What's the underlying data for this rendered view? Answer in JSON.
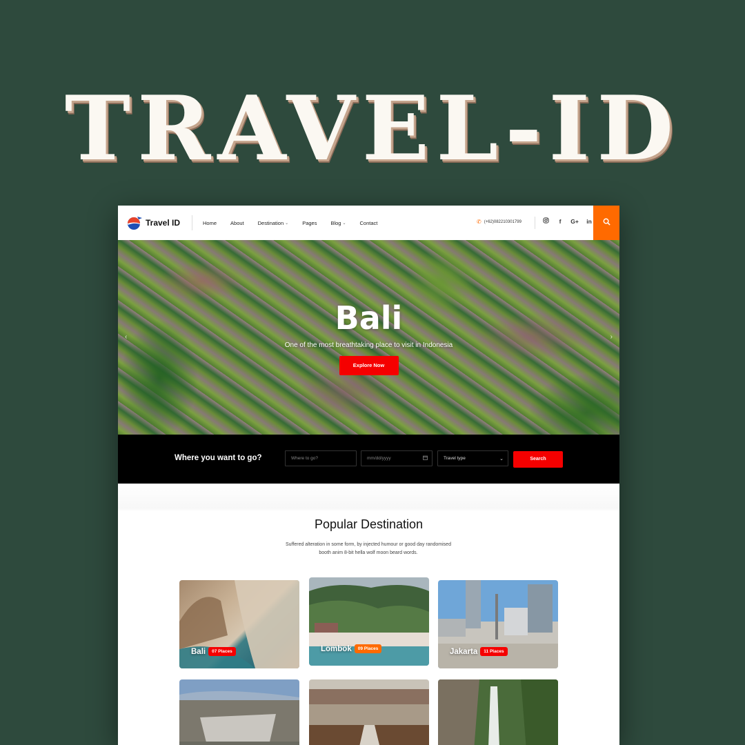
{
  "poster": {
    "title": "TRAVEL-ID"
  },
  "header": {
    "logo_text": "Travel ID",
    "nav": [
      {
        "label": "Home",
        "dropdown": false
      },
      {
        "label": "About",
        "dropdown": false
      },
      {
        "label": "Destination",
        "dropdown": true
      },
      {
        "label": "Pages",
        "dropdown": false
      },
      {
        "label": "Blog",
        "dropdown": true
      },
      {
        "label": "Contact",
        "dropdown": false
      }
    ],
    "phone": "(+62)082210301799",
    "socials": [
      "instagram-icon",
      "facebook-icon",
      "google-plus-icon",
      "linkedin-icon"
    ],
    "social_glyphs": {
      "fb": "f",
      "gp": "G+",
      "li": "in"
    },
    "search_icon": "search-icon",
    "accent": "#ff6a00"
  },
  "hero": {
    "title": "Bali",
    "subtitle": "One of the most breathtaking place to visit in Indonesia",
    "cta": "Explore Now",
    "cta_color": "#f50000"
  },
  "search": {
    "label": "Where you want to go?",
    "where_placeholder": "Where to go?",
    "date_placeholder": "mm/dd/yyyy",
    "travel_type": "Travel type",
    "button": "Search"
  },
  "popular": {
    "title": "Popular Destination",
    "description": "Suffered alteration in some form, by injected humour or good day randomised booth anim 8-bit hella wolf moon beard words.",
    "cards": [
      {
        "name": "Bali",
        "badge": "07 Places",
        "badge_color": "#f50000"
      },
      {
        "name": "Lombok",
        "badge": "09 Places",
        "badge_color": "#ff6a00"
      },
      {
        "name": "Jakarta",
        "badge": "11 Places",
        "badge_color": "#f50000"
      },
      {
        "name": "",
        "badge": ""
      },
      {
        "name": "",
        "badge": ""
      },
      {
        "name": "",
        "badge": ""
      }
    ]
  }
}
